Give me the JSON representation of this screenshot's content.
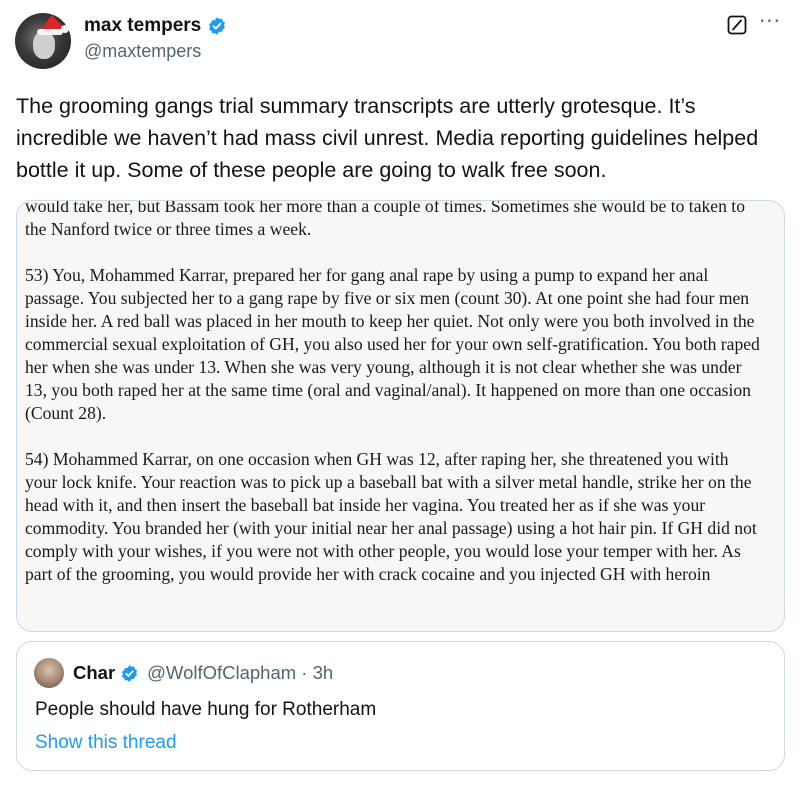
{
  "author": {
    "display_name": "max tempers",
    "handle": "@maxtempers",
    "verified_icon": "verified-badge-icon",
    "accent_color": "#1d9bf0"
  },
  "actions": {
    "grok_icon": "grok-icon",
    "more_label": "···"
  },
  "tweet": {
    "text": "The grooming gangs trial summary transcripts are utterly grotesque. It’s incredible we haven’t had mass civil unrest. Media reporting guidelines helped bottle it up. Some of these people are going to walk free soon."
  },
  "media": {
    "paragraphs": [
      "would take her, but Bassam took her more than a couple of times. Sometimes she would be to taken to the Nanford twice or three times a week.",
      "53) You, Mohammed Karrar, prepared her for gang anal rape by using a pump to expand her anal passage. You subjected her to a gang rape by five or six men (count 30). At one point she had four men inside her. A red ball was placed in her mouth to keep her quiet. Not only were you both involved in the commercial sexual exploitation of GH, you also used her for your own self-gratification. You both raped her when she was under 13. When she was very young, although it is not clear whether she was under 13, you both raped her at the same time (oral and vaginal/anal). It happened on more than one occasion (Count 28).",
      "54) Mohammed Karrar, on one occasion when GH was 12, after raping her, she threatened you with your lock knife. Your reaction was to pick up a baseball bat with a silver metal handle, strike her on the head with it, and then insert the baseball bat inside her vagina. You treated her as if she was your commodity. You branded her (with your initial near her anal passage) using a hot hair pin. If GH did not comply with your wishes, if you were not with other people, you would lose your temper with her. As part of the grooming, you would provide her with crack cocaine and you injected GH with heroin"
    ]
  },
  "quote": {
    "display_name": "Char",
    "handle_time": "@WolfOfClapham · 3h",
    "text": "People should have hung for Rotherham",
    "show_thread": "Show this thread"
  }
}
